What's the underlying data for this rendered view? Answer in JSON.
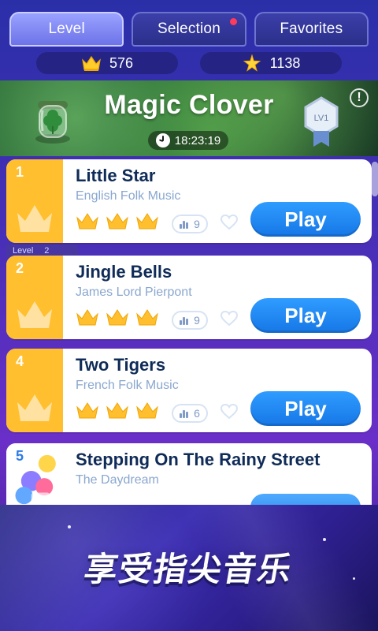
{
  "tabs": [
    {
      "label": "Level",
      "active": true
    },
    {
      "label": "Selection",
      "active": false,
      "has_dot": true
    },
    {
      "label": "Favorites",
      "active": false
    }
  ],
  "currency": {
    "crowns": "576",
    "stars": "1138"
  },
  "header": {
    "title": "Magic Clover",
    "timer": "18:23:19",
    "level_badge": "LV1",
    "info": "!"
  },
  "level_marker": {
    "label": "Level",
    "value": "2"
  },
  "songs": [
    {
      "rank": "1",
      "title": "Little Star",
      "artist": "English Folk Music",
      "plays": "9",
      "play_label": "Play"
    },
    {
      "rank": "2",
      "title": "Jingle Bells",
      "artist": "James Lord Pierpont",
      "plays": "9",
      "play_label": "Play"
    },
    {
      "rank": "4",
      "title": "Two Tigers",
      "artist": "French Folk Music",
      "plays": "6",
      "play_label": "Play"
    },
    {
      "rank": "5",
      "title": "Stepping On The Rainy Street",
      "artist": "The Daydream",
      "plays": "",
      "play_label": ""
    }
  ],
  "promo_text": "享受指尖音乐",
  "colors": {
    "accent": "#1677e6",
    "gold": "#ffbf2e",
    "tab_active": "#6d73e8"
  }
}
